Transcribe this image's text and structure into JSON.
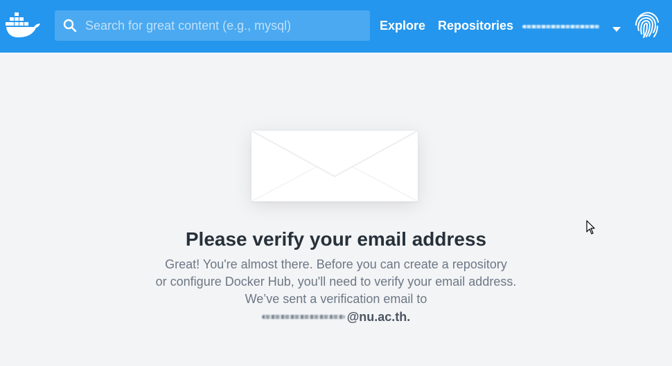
{
  "header": {
    "search_placeholder": "Search for great content (e.g., mysql)",
    "nav": {
      "explore": "Explore",
      "repositories": "Repositories"
    },
    "icons": {
      "logo": "docker-whale-icon",
      "search": "search-icon",
      "caret": "caret-down-icon",
      "fingerprint": "fingerprint-icon"
    }
  },
  "main": {
    "title": "Please verify your email address",
    "message_line_1": "Great! You're almost there. Before you can create a repository",
    "message_line_2": "or configure Docker Hub, you'll need to verify your email address.",
    "message_line_3": "We’ve sent a verification email to",
    "email_domain": "@nu.ac.th."
  },
  "colors": {
    "header_bg": "#2496ed",
    "page_bg": "#f3f4f6",
    "title_text": "#27313a",
    "body_text": "#6c7784"
  }
}
